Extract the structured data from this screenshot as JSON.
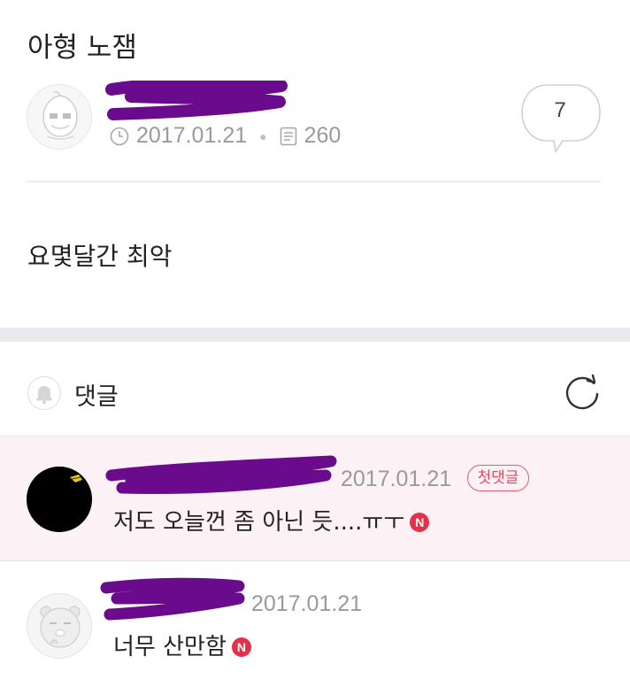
{
  "post": {
    "title": "아형 노잼",
    "date": "2017.01.21",
    "views": "260",
    "comment_count": "7",
    "body": "요몇달간 최악"
  },
  "comments_section": {
    "label": "댓글"
  },
  "comments": [
    {
      "date": "2017.01.21",
      "badge": "첫댓글",
      "text": "저도 오늘껀 좀 아닌 듯....ㅠㅜ",
      "new_mark": "N"
    },
    {
      "date": "2017.01.21",
      "text": "너무 산만함",
      "new_mark": "N"
    }
  ],
  "colors": {
    "redaction": "#6a0a8c",
    "highlight_bg": "#fcf1f4",
    "badge_red": "#e5304a",
    "meta_gray": "#9a9a9a"
  }
}
